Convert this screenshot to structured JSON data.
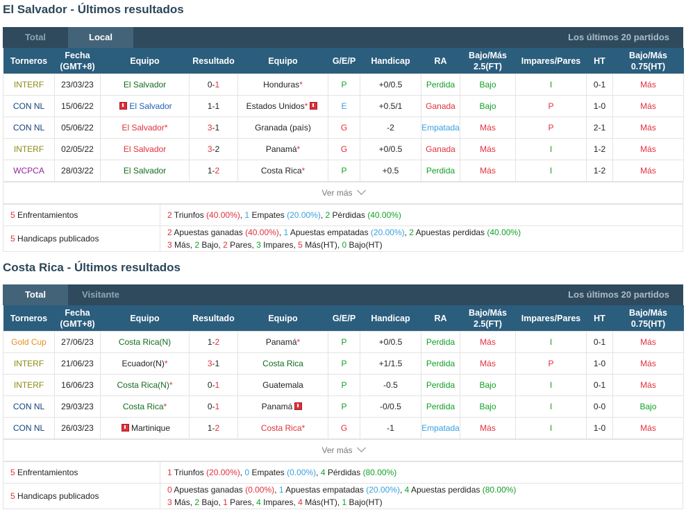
{
  "columns": [
    "Torneros",
    "Fecha\n(GMT+8)",
    "Equipo",
    "Resultado",
    "Equipo",
    "G/E/P",
    "Handicap",
    "RA",
    "Bajo/Más\n2.5(FT)",
    "Impares/Pares",
    "HT",
    "Bajo/Más\n0.75(HT)"
  ],
  "colors": {
    "header_bg": "#2b5d7d",
    "tabbar_bg": "#2f4a5c",
    "tab_active_bg": "#436379",
    "title": "#2b4659",
    "win_red": "#e0303c",
    "loss_green": "#12a026",
    "draw_blue": "#37a0e0"
  },
  "sections": [
    {
      "title": "El Salvador - Últimos resultados",
      "tabs": [
        {
          "label": "Total",
          "active": false
        },
        {
          "label": "Local",
          "active": true
        }
      ],
      "last_label": "Los últimos 20 partidos",
      "rows": [
        {
          "tournament": "INTERF",
          "tcolor": "olive",
          "date": "23/03/23",
          "home": {
            "pre": "",
            "name": "El Salvador",
            "post": "",
            "color": "dgreen",
            "flag": false,
            "star": false
          },
          "score_h": "0",
          "score_a": "1",
          "hcolor": "",
          "acolor": "red",
          "away": {
            "pre": "",
            "name": "Honduras",
            "post": "",
            "color": "",
            "flag": false,
            "star": true
          },
          "gep": "P",
          "handicap": "+0/0.5",
          "ra": "Perdida",
          "ou": "Bajo",
          "oe": "I",
          "ht": "0-1",
          "ou_ht": "Más"
        },
        {
          "tournament": "CON NL",
          "tcolor": "navy",
          "date": "15/06/22",
          "home": {
            "pre": "",
            "name": "El Salvador",
            "post": "",
            "color": "blue",
            "flag": true,
            "star": false
          },
          "score_h": "1",
          "score_a": "1",
          "hcolor": "",
          "acolor": "",
          "away": {
            "pre": "",
            "name": "Estados Unidos",
            "post": "",
            "color": "",
            "flag": false,
            "star": true,
            "flag_after": true
          },
          "gep": "E",
          "handicap": "+0.5/1",
          "ra": "Ganada",
          "ou": "Bajo",
          "oe": "P",
          "ht": "1-0",
          "ou_ht": "Más"
        },
        {
          "tournament": "CON NL",
          "tcolor": "navy",
          "date": "05/06/22",
          "home": {
            "pre": "",
            "name": "El Salvador",
            "post": "",
            "color": "red",
            "flag": false,
            "star": true
          },
          "score_h": "3",
          "score_a": "1",
          "hcolor": "red",
          "acolor": "",
          "away": {
            "pre": "",
            "name": "Granada (país)",
            "post": "",
            "color": "",
            "flag": false,
            "star": false
          },
          "gep": "G",
          "handicap": "-2",
          "ra": "Empatada",
          "ou": "Más",
          "oe": "P",
          "ht": "2-1",
          "ou_ht": "Más"
        },
        {
          "tournament": "INTERF",
          "tcolor": "olive",
          "date": "02/05/22",
          "home": {
            "pre": "",
            "name": "El Salvador",
            "post": "",
            "color": "red",
            "flag": false,
            "star": false
          },
          "score_h": "3",
          "score_a": "2",
          "hcolor": "red",
          "acolor": "",
          "away": {
            "pre": "",
            "name": "Panamá",
            "post": "",
            "color": "",
            "flag": false,
            "star": true
          },
          "gep": "G",
          "handicap": "+0/0.5",
          "ra": "Ganada",
          "ou": "Más",
          "oe": "I",
          "ht": "1-2",
          "ou_ht": "Más"
        },
        {
          "tournament": "WCPCA",
          "tcolor": "purple",
          "date": "28/03/22",
          "home": {
            "pre": "",
            "name": "El Salvador",
            "post": "",
            "color": "dgreen",
            "flag": false,
            "star": false
          },
          "score_h": "1",
          "score_a": "2",
          "hcolor": "",
          "acolor": "red",
          "away": {
            "pre": "",
            "name": "Costa Rica",
            "post": "",
            "color": "",
            "flag": false,
            "star": true
          },
          "gep": "P",
          "handicap": "+0.5",
          "ra": "Perdida",
          "ou": "Más",
          "oe": "I",
          "ht": "1-2",
          "ou_ht": "Más"
        }
      ],
      "ver_mas": "Ver más",
      "summary1_label": "Enfrentamientos",
      "summary1_n": "5",
      "summary1": [
        [
          "2",
          "red"
        ],
        [
          " Triunfos ",
          ""
        ],
        [
          "(40.00%)",
          "red"
        ],
        [
          ", ",
          ""
        ],
        [
          "1",
          "lblue"
        ],
        [
          " Empates ",
          ""
        ],
        [
          "(20.00%)",
          "lblue"
        ],
        [
          ", ",
          ""
        ],
        [
          "2",
          "green"
        ],
        [
          " Pérdidas ",
          ""
        ],
        [
          "(40.00%)",
          "green"
        ]
      ],
      "summary2_label": "Handicaps publicados",
      "summary2_n": "5",
      "summary2a": [
        [
          "2",
          "red"
        ],
        [
          " Apuestas ganadas ",
          ""
        ],
        [
          "(40.00%)",
          "red"
        ],
        [
          ", ",
          ""
        ],
        [
          "1",
          "lblue"
        ],
        [
          " Apuestas empatadas ",
          ""
        ],
        [
          "(20.00%)",
          "lblue"
        ],
        [
          ", ",
          ""
        ],
        [
          "2",
          "green"
        ],
        [
          " Apuestas perdidas ",
          ""
        ],
        [
          "(40.00%)",
          "green"
        ]
      ],
      "summary2b": [
        [
          "3",
          "red"
        ],
        [
          " Más, ",
          ""
        ],
        [
          "2",
          "green"
        ],
        [
          " Bajo, ",
          ""
        ],
        [
          "2",
          "red"
        ],
        [
          " Pares, ",
          ""
        ],
        [
          "3",
          "green"
        ],
        [
          " Impares, ",
          ""
        ],
        [
          "5",
          "red"
        ],
        [
          " Más(HT), ",
          ""
        ],
        [
          "0",
          "green"
        ],
        [
          " Bajo(HT)",
          ""
        ]
      ]
    },
    {
      "title": "Costa Rica - Últimos resultados",
      "tabs": [
        {
          "label": "Total",
          "active": true
        },
        {
          "label": "Visitante",
          "active": false
        }
      ],
      "last_label": "Los últimos 20 partidos",
      "rows": [
        {
          "tournament": "Gold Cup",
          "tcolor": "orange",
          "date": "27/06/23",
          "home": {
            "pre": "",
            "name": "Costa Rica",
            "post": "(N)",
            "color": "dgreen",
            "flag": false,
            "star": false
          },
          "score_h": "1",
          "score_a": "2",
          "hcolor": "",
          "acolor": "red",
          "away": {
            "pre": "",
            "name": "Panamá",
            "post": "",
            "color": "",
            "flag": false,
            "star": true
          },
          "gep": "P",
          "handicap": "+0/0.5",
          "ra": "Perdida",
          "ou": "Más",
          "oe": "I",
          "ht": "0-1",
          "ou_ht": "Más"
        },
        {
          "tournament": "INTERF",
          "tcolor": "olive",
          "date": "21/06/23",
          "home": {
            "pre": "",
            "name": "Ecuador",
            "post": "(N)",
            "color": "",
            "flag": false,
            "star": true
          },
          "score_h": "3",
          "score_a": "1",
          "hcolor": "red",
          "acolor": "",
          "away": {
            "pre": "",
            "name": "Costa Rica",
            "post": "",
            "color": "dgreen",
            "flag": false,
            "star": false
          },
          "gep": "P",
          "handicap": "+1/1.5",
          "ra": "Perdida",
          "ou": "Más",
          "oe": "P",
          "ht": "1-0",
          "ou_ht": "Más"
        },
        {
          "tournament": "INTERF",
          "tcolor": "olive",
          "date": "16/06/23",
          "home": {
            "pre": "",
            "name": "Costa Rica",
            "post": "(N)",
            "color": "dgreen",
            "flag": false,
            "star": true
          },
          "score_h": "0",
          "score_a": "1",
          "hcolor": "",
          "acolor": "red",
          "away": {
            "pre": "",
            "name": "Guatemala",
            "post": "",
            "color": "",
            "flag": false,
            "star": false
          },
          "gep": "P",
          "handicap": "-0.5",
          "ra": "Perdida",
          "ou": "Bajo",
          "oe": "I",
          "ht": "0-1",
          "ou_ht": "Más"
        },
        {
          "tournament": "CON NL",
          "tcolor": "navy",
          "date": "29/03/23",
          "home": {
            "pre": "",
            "name": "Costa Rica",
            "post": "",
            "color": "dgreen",
            "flag": false,
            "star": true
          },
          "score_h": "0",
          "score_a": "1",
          "hcolor": "",
          "acolor": "red",
          "away": {
            "pre": "",
            "name": "Panamá",
            "post": "",
            "color": "",
            "flag": false,
            "star": false,
            "flag_after": true
          },
          "gep": "P",
          "handicap": "-0/0.5",
          "ra": "Perdida",
          "ou": "Bajo",
          "oe": "I",
          "ht": "0-0",
          "ou_ht": "Bajo"
        },
        {
          "tournament": "CON NL",
          "tcolor": "navy",
          "date": "26/03/23",
          "home": {
            "pre": "",
            "name": "Martinique",
            "post": "",
            "color": "",
            "flag": true,
            "star": false
          },
          "score_h": "1",
          "score_a": "2",
          "hcolor": "",
          "acolor": "red",
          "away": {
            "pre": "",
            "name": "Costa Rica",
            "post": "",
            "color": "red",
            "flag": false,
            "star": true
          },
          "gep": "G",
          "handicap": "-1",
          "ra": "Empatada",
          "ou": "Más",
          "oe": "I",
          "ht": "1-0",
          "ou_ht": "Más"
        }
      ],
      "ver_mas": "Ver más",
      "summary1_label": "Enfrentamientos",
      "summary1_n": "5",
      "summary1": [
        [
          "1",
          "red"
        ],
        [
          " Triunfos ",
          ""
        ],
        [
          "(20.00%)",
          "red"
        ],
        [
          ", ",
          ""
        ],
        [
          "0",
          "lblue"
        ],
        [
          " Empates ",
          ""
        ],
        [
          "(0.00%)",
          "lblue"
        ],
        [
          ", ",
          ""
        ],
        [
          "4",
          "green"
        ],
        [
          " Pérdidas ",
          ""
        ],
        [
          "(80.00%)",
          "green"
        ]
      ],
      "summary2_label": "Handicaps publicados",
      "summary2_n": "5",
      "summary2a": [
        [
          "0",
          "red"
        ],
        [
          " Apuestas ganadas ",
          ""
        ],
        [
          "(0.00%)",
          "red"
        ],
        [
          ", ",
          ""
        ],
        [
          "1",
          "lblue"
        ],
        [
          " Apuestas empatadas ",
          ""
        ],
        [
          "(20.00%)",
          "lblue"
        ],
        [
          ", ",
          ""
        ],
        [
          "4",
          "green"
        ],
        [
          " Apuestas perdidas ",
          ""
        ],
        [
          "(80.00%)",
          "green"
        ]
      ],
      "summary2b": [
        [
          "3",
          "red"
        ],
        [
          " Más, ",
          ""
        ],
        [
          "2",
          "green"
        ],
        [
          " Bajo, ",
          ""
        ],
        [
          "1",
          "red"
        ],
        [
          " Pares, ",
          ""
        ],
        [
          "4",
          "green"
        ],
        [
          " Impares, ",
          ""
        ],
        [
          "4",
          "red"
        ],
        [
          " Más(HT), ",
          ""
        ],
        [
          "1",
          "green"
        ],
        [
          " Bajo(HT)",
          ""
        ]
      ]
    }
  ]
}
